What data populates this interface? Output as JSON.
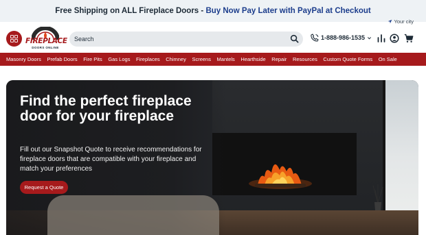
{
  "promo": {
    "shipping": "Free Shipping on ALL Fireplace Doors",
    "separator": " - ",
    "paypal": "Buy Now Pay Later with PayPal at Checkout"
  },
  "location": {
    "label": "Your city"
  },
  "logo": {
    "word": "FIREPLACE",
    "sub": "DOORS ONLINE"
  },
  "search": {
    "placeholder": "Search"
  },
  "phone": {
    "number": "1-888-986-1535"
  },
  "nav": {
    "items": [
      "Masonry Doors",
      "Prefab Doors",
      "Fire Pits",
      "Gas Logs",
      "Fireplaces",
      "Chimney",
      "Screens",
      "Mantels",
      "Hearthside",
      "Repair",
      "Resources",
      "Custom Quote Forms",
      "On Sale"
    ]
  },
  "hero": {
    "title": "Find the perfect fireplace door for your fireplace",
    "body": "Fill out our Snapshot Quote to receive recommendations for fireplace doors that are compatible with your fireplace and match your preferences",
    "cta": "Request a Quote"
  },
  "colors": {
    "brand": "#a61a1c",
    "promo_bg": "#eef2f5",
    "paypal": "#1c3d8c"
  },
  "icons": [
    "menu-grid-icon",
    "search-icon",
    "phone-icon",
    "chevron-down-icon",
    "compare-icon",
    "user-icon",
    "cart-icon",
    "location-arrow-icon"
  ]
}
